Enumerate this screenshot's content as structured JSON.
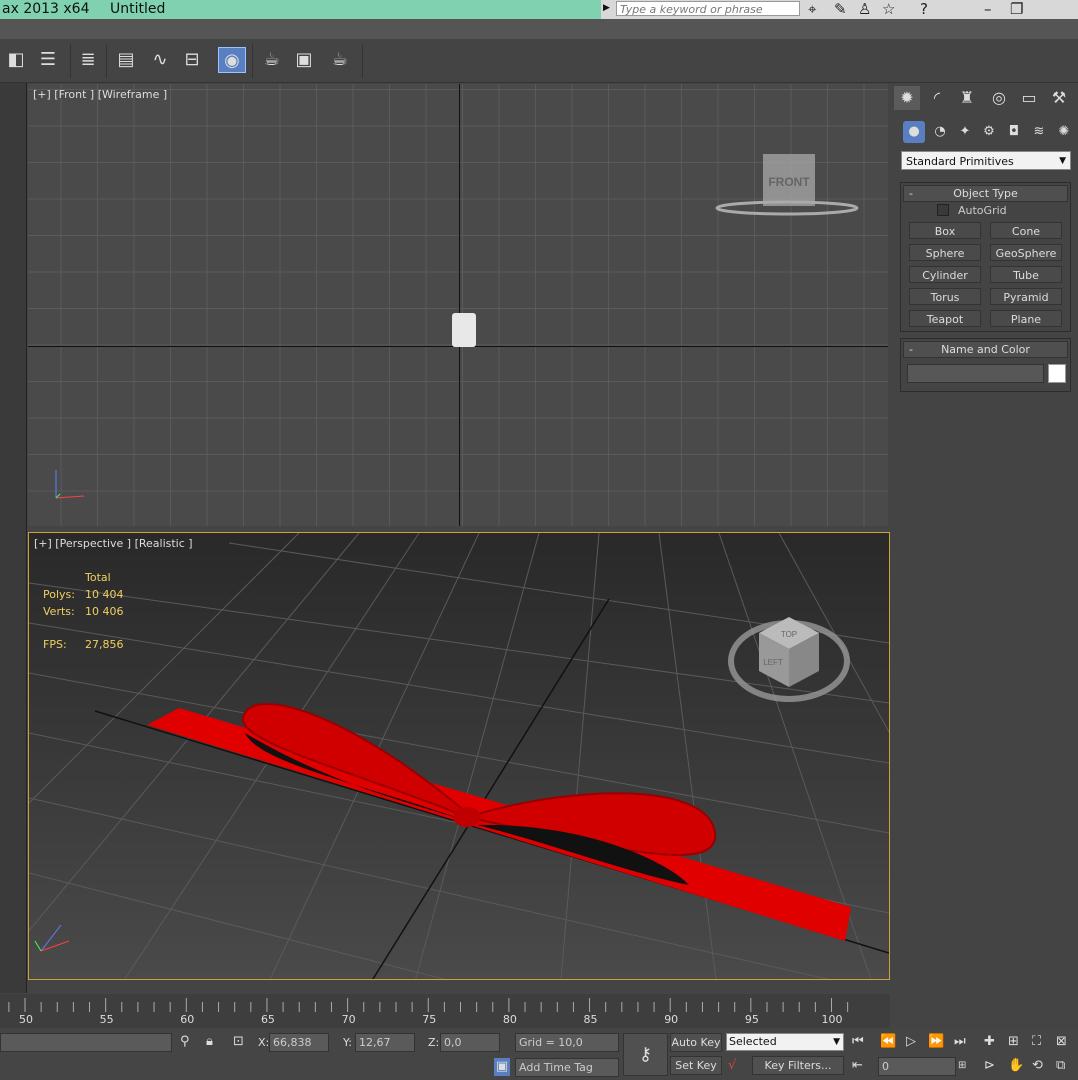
{
  "titlebar": {
    "app_title": "ax  2013 x64",
    "doc_title": "Untitled",
    "search_placeholder": "Type a keyword or phrase",
    "icons": [
      "binoculars-icon",
      "wrench-icon",
      "user-icon",
      "star-icon",
      "help-icon",
      "minimize-icon",
      "restore-icon"
    ]
  },
  "toolbar": {
    "tools": [
      {
        "name": "mirror-icon",
        "glyph": "◧"
      },
      {
        "name": "align-icon",
        "glyph": "☰"
      },
      {
        "name": "layer-manager-icon",
        "glyph": "≣"
      },
      {
        "name": "graphite-toggle-icon",
        "glyph": "▤"
      },
      {
        "name": "curve-editor-icon",
        "glyph": "∿"
      },
      {
        "name": "schematic-view-icon",
        "glyph": "⊟"
      },
      {
        "name": "material-editor-icon",
        "glyph": "◉"
      },
      {
        "name": "render-setup-icon",
        "glyph": "☕"
      },
      {
        "name": "rendered-frame-icon",
        "glyph": "▣"
      },
      {
        "name": "render-production-icon",
        "glyph": "☕"
      }
    ]
  },
  "viewports": {
    "front": {
      "label": "[+] [Front ] [Wireframe ]",
      "viewcube": "FRONT"
    },
    "perspective": {
      "label": "[+] [Perspective ] [Realistic ]",
      "stats": {
        "total_label": "Total",
        "polys_label": "Polys:",
        "polys": "10 404",
        "verts_label": "Verts:",
        "verts": "10 406",
        "fps_label": "FPS:",
        "fps": "27,856"
      },
      "viewcube_top": "TOP",
      "viewcube_left": "LEFT"
    }
  },
  "command_panel": {
    "tabs": [
      "create-tab-icon",
      "modify-tab-icon",
      "hierarchy-tab-icon",
      "motion-tab-icon",
      "display-tab-icon",
      "utilities-tab-icon"
    ],
    "subtabs": [
      "geometry-icon",
      "shapes-icon",
      "lights-icon",
      "cameras-icon",
      "helpers-icon",
      "spacewarps-icon",
      "systems-icon"
    ],
    "category": "Standard Primitives",
    "object_type": {
      "title": "Object Type",
      "minus": "-",
      "autogrid": "AutoGrid",
      "buttons": [
        "Box",
        "Cone",
        "Sphere",
        "GeoSphere",
        "Cylinder",
        "Tube",
        "Torus",
        "Pyramid",
        "Teapot",
        "Plane"
      ]
    },
    "name_color": {
      "title": "Name and Color",
      "minus": "-",
      "color": "#ffffff"
    }
  },
  "timeline": {
    "ticks": [
      "50",
      "55",
      "60",
      "65",
      "70",
      "75",
      "80",
      "85",
      "90",
      "95",
      "100"
    ]
  },
  "status": {
    "x_label": "X:",
    "x": "66,838",
    "y_label": "Y:",
    "y": "12,67",
    "z_label": "Z:",
    "z": "0,0",
    "grid": "Grid = 10,0",
    "add_time_tag": "Add Time Tag",
    "auto_key": "Auto Key",
    "set_key": "Set Key",
    "selected": "Selected",
    "key_filters": "Key Filters...",
    "frame": "0"
  },
  "colors": {
    "ribbon": "#e00000",
    "viewport_border": "#c9a23a",
    "stats_text": "#f0d060"
  }
}
